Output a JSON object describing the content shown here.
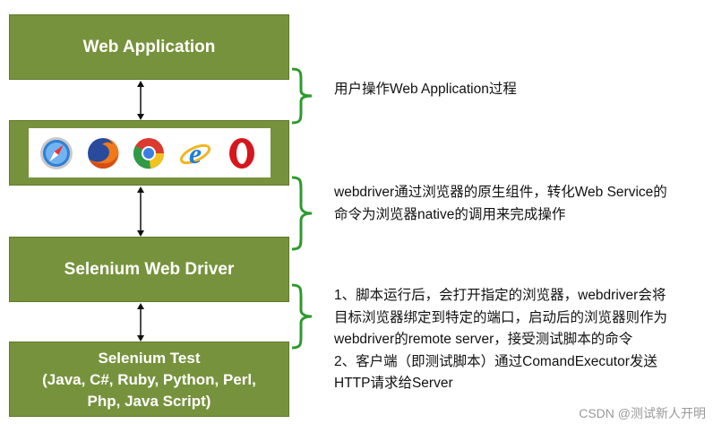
{
  "boxes": {
    "web_application": "Web Application",
    "selenium_web_driver": "Selenium Web Driver",
    "selenium_test_title": "Selenium Test",
    "selenium_test_langs_1": "(Java, C#, Ruby, Python, Perl,",
    "selenium_test_langs_2": "Php, Java Script)"
  },
  "browsers": [
    "safari-icon",
    "firefox-icon",
    "chrome-icon",
    "internet-explorer-icon",
    "opera-icon"
  ],
  "notes": {
    "note1": [
      "用户操作Web Application过程"
    ],
    "note2": [
      "webdriver通过浏览器的原生组件，转化Web Service的",
      "命令为浏览器native的调用来完成操作"
    ],
    "note3": [
      "1、脚本运行后，会打开指定的浏览器，webdriver会将",
      "目标浏览器绑定到特定的端口，启动后的浏览器则作为",
      "webdriver的remote server，接受测试脚本的命令",
      "2、客户端（即测试脚本）通过ComandExecutor发送",
      "HTTP请求给Server"
    ]
  },
  "colors": {
    "box_green": "#77923c",
    "brace_green": "#2e9a2e",
    "arrow": "#111111"
  },
  "watermark": "CSDN @测试新人开明"
}
